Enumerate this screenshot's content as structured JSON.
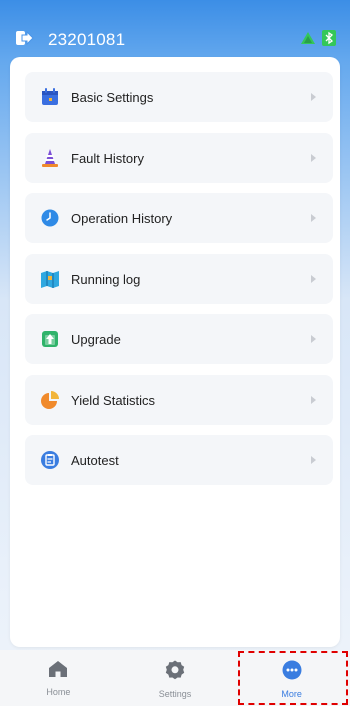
{
  "header": {
    "device_id": "23201081",
    "exit_icon": "exit-icon",
    "status_icons": [
      "signal-icon",
      "bluetooth-icon"
    ],
    "status_color": "#34c759"
  },
  "menu": {
    "items": [
      {
        "label": "Basic Settings",
        "icon": "calendar-settings-icon",
        "color": "#3a6fe0"
      },
      {
        "label": "Fault History",
        "icon": "traffic-cone-icon",
        "color": "#7b4fd6"
      },
      {
        "label": "Operation History",
        "icon": "clock-icon",
        "color": "#2f8ae6"
      },
      {
        "label": "Running log",
        "icon": "map-icon",
        "color": "#2fa8e0"
      },
      {
        "label": "Upgrade",
        "icon": "upgrade-icon",
        "color": "#2fb36a"
      },
      {
        "label": "Yield Statistics",
        "icon": "pie-chart-icon",
        "color": "#f08a2c"
      },
      {
        "label": "Autotest",
        "icon": "clipboard-icon",
        "color": "#3a7de0"
      }
    ]
  },
  "tabbar": {
    "tabs": [
      {
        "label": "Home",
        "icon": "home-icon",
        "active": false
      },
      {
        "label": "Settings",
        "icon": "gear-icon",
        "active": false
      },
      {
        "label": "More",
        "icon": "more-icon",
        "active": true
      }
    ]
  },
  "colors": {
    "accent": "#3a7de0",
    "highlight": "#e00000"
  }
}
